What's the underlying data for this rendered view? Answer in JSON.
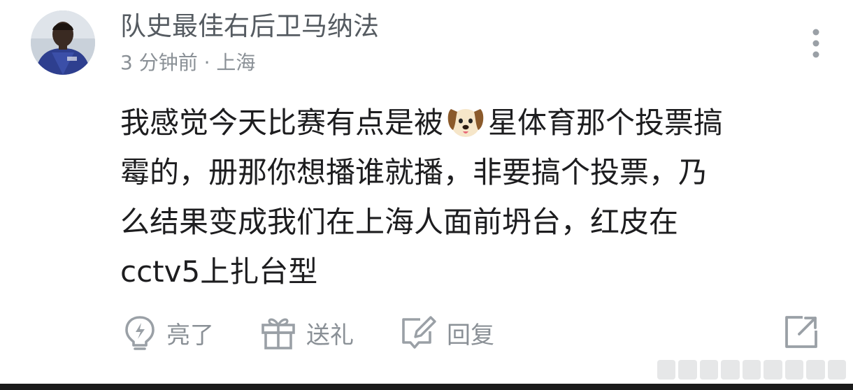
{
  "user": {
    "name": "队史最佳右后卫马纳法",
    "meta": "3 分钟前 · 上海"
  },
  "comment": {
    "line1_before": "我感觉今天比赛有点是被",
    "emoji": "dog-face-emoji",
    "line1_after": "星体育那个投票搞",
    "line2": "霉的，册那你想播谁就播，非要搞个投票，乃",
    "line3": "么结果变成我们在上海人面前坍台，红皮在",
    "line4": "cctv5上扎台型"
  },
  "actions": {
    "like": {
      "icon": "lightning-bulb-icon",
      "label": "亮了"
    },
    "gift": {
      "icon": "gift-icon",
      "label": "送礼"
    },
    "reply": {
      "icon": "edit-reply-icon",
      "label": "回复"
    },
    "share": {
      "icon": "share-external-icon"
    }
  },
  "colors": {
    "text_primary": "#1d1d1f",
    "text_secondary": "#8a9096",
    "username": "#555b61"
  }
}
